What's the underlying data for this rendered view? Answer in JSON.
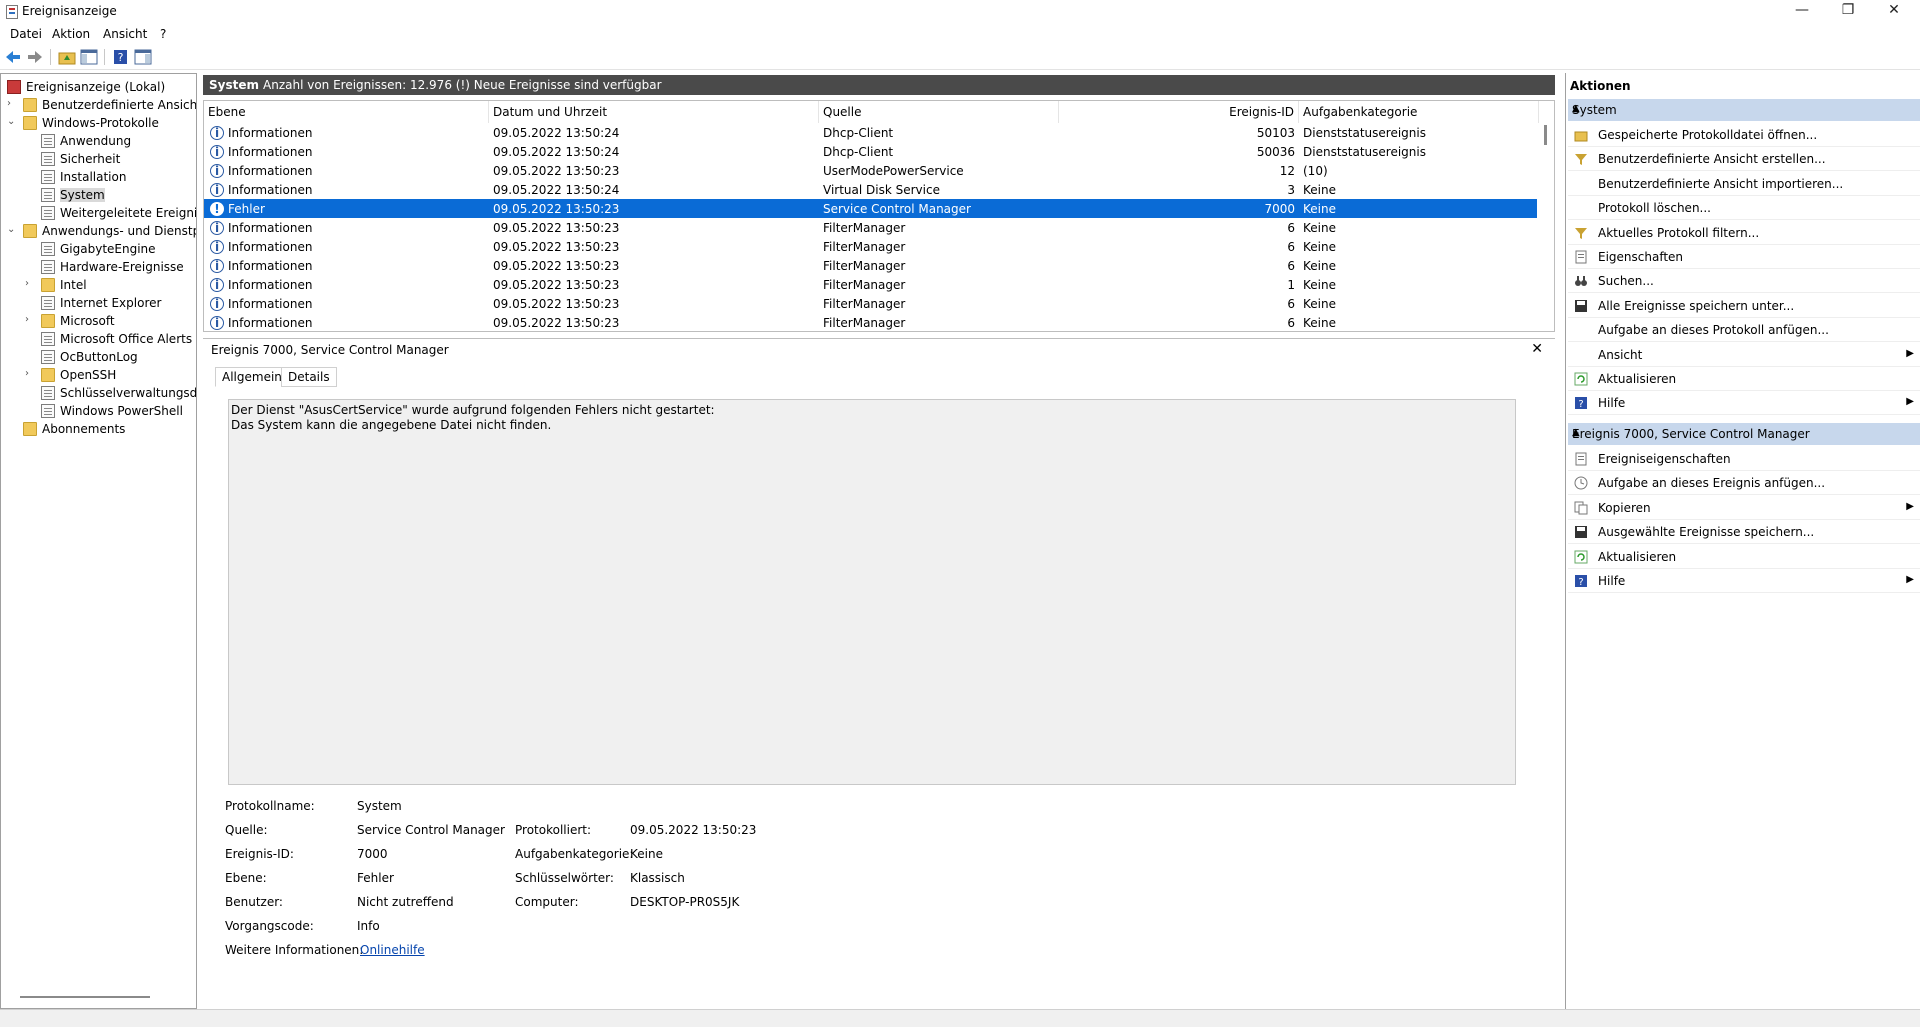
{
  "window": {
    "title": "Ereignisanzeige",
    "buttons": {
      "minimize": "—",
      "maximize": "❐",
      "close": "✕"
    }
  },
  "menu": [
    "Datei",
    "Aktion",
    "Ansicht",
    "?"
  ],
  "tree": [
    {
      "label": "Ereignisanzeige (Lokal)",
      "level": 0,
      "icon": "root"
    },
    {
      "label": "Benutzerdefinierte Ansichten",
      "level": 1,
      "icon": "folder",
      "expander": "›"
    },
    {
      "label": "Windows-Protokolle",
      "level": 1,
      "icon": "folder",
      "expander": "⌄"
    },
    {
      "label": "Anwendung",
      "level": 2,
      "icon": "log"
    },
    {
      "label": "Sicherheit",
      "level": 2,
      "icon": "log"
    },
    {
      "label": "Installation",
      "level": 2,
      "icon": "log"
    },
    {
      "label": "System",
      "level": 2,
      "icon": "log",
      "selected": true
    },
    {
      "label": "Weitergeleitete Ereignisse",
      "level": 2,
      "icon": "log"
    },
    {
      "label": "Anwendungs- und Dienstprotokolle",
      "level": 1,
      "icon": "folder",
      "expander": "⌄"
    },
    {
      "label": "GigabyteEngine",
      "level": 2,
      "icon": "log"
    },
    {
      "label": "Hardware-Ereignisse",
      "level": 2,
      "icon": "log"
    },
    {
      "label": "Intel",
      "level": 2,
      "icon": "folder",
      "expander": "›"
    },
    {
      "label": "Internet Explorer",
      "level": 2,
      "icon": "log"
    },
    {
      "label": "Microsoft",
      "level": 2,
      "icon": "folder",
      "expander": "›"
    },
    {
      "label": "Microsoft Office Alerts",
      "level": 2,
      "icon": "log"
    },
    {
      "label": "OcButtonLog",
      "level": 2,
      "icon": "log"
    },
    {
      "label": "OpenSSH",
      "level": 2,
      "icon": "folder",
      "expander": "›"
    },
    {
      "label": "Schlüsselverwaltungsdienst",
      "level": 2,
      "icon": "log"
    },
    {
      "label": "Windows PowerShell",
      "level": 2,
      "icon": "log"
    },
    {
      "label": "Abonnements",
      "level": 1,
      "icon": "folder"
    }
  ],
  "list_header": {
    "name": "System",
    "count_text": "Anzahl von Ereignissen: 12.976 (!) Neue Ereignisse sind verfügbar"
  },
  "columns": [
    "Ebene",
    "Datum und Uhrzeit",
    "Quelle",
    "Ereignis-ID",
    "Aufgabenkategorie"
  ],
  "events": [
    {
      "level": "Informationen",
      "date": "09.05.2022 13:50:24",
      "source": "Dhcp-Client",
      "id": "50103",
      "category": "Dienststatusereignis"
    },
    {
      "level": "Informationen",
      "date": "09.05.2022 13:50:24",
      "source": "Dhcp-Client",
      "id": "50036",
      "category": "Dienststatusereignis"
    },
    {
      "level": "Informationen",
      "date": "09.05.2022 13:50:23",
      "source": "UserModePowerService",
      "id": "12",
      "category": "(10)"
    },
    {
      "level": "Informationen",
      "date": "09.05.2022 13:50:24",
      "source": "Virtual Disk Service",
      "id": "3",
      "category": "Keine"
    },
    {
      "level": "Fehler",
      "date": "09.05.2022 13:50:23",
      "source": "Service Control Manager",
      "id": "7000",
      "category": "Keine",
      "selected": true
    },
    {
      "level": "Informationen",
      "date": "09.05.2022 13:50:23",
      "source": "FilterManager",
      "id": "6",
      "category": "Keine"
    },
    {
      "level": "Informationen",
      "date": "09.05.2022 13:50:23",
      "source": "FilterManager",
      "id": "6",
      "category": "Keine"
    },
    {
      "level": "Informationen",
      "date": "09.05.2022 13:50:23",
      "source": "FilterManager",
      "id": "6",
      "category": "Keine"
    },
    {
      "level": "Informationen",
      "date": "09.05.2022 13:50:23",
      "source": "FilterManager",
      "id": "1",
      "category": "Keine"
    },
    {
      "level": "Informationen",
      "date": "09.05.2022 13:50:23",
      "source": "FilterManager",
      "id": "6",
      "category": "Keine"
    },
    {
      "level": "Informationen",
      "date": "09.05.2022 13:50:23",
      "source": "FilterManager",
      "id": "6",
      "category": "Keine"
    }
  ],
  "detail": {
    "title": "Ereignis 7000, Service Control Manager",
    "close": "✕",
    "tabs": [
      "Allgemein",
      "Details"
    ],
    "message_line1": "Der Dienst \"AsusCertService\" wurde aufgrund folgenden Fehlers nicht gestartet:",
    "message_line2": "Das System kann die angegebene Datei nicht finden.",
    "props": {
      "protokollname_label": "Protokollname:",
      "protokollname": "System",
      "quelle_label": "Quelle:",
      "quelle": "Service Control Manager",
      "protokolliert_label": "Protokolliert:",
      "protokolliert": "09.05.2022 13:50:23",
      "id_label": "Ereignis-ID:",
      "id": "7000",
      "kategorie_label": "Aufgabenkategorie:",
      "kategorie": "Keine",
      "ebene_label": "Ebene:",
      "ebene": "Fehler",
      "schluessel_label": "Schlüsselwörter:",
      "schluessel": "Klassisch",
      "benutzer_label": "Benutzer:",
      "benutzer": "Nicht zutreffend",
      "computer_label": "Computer:",
      "computer": "DESKTOP-PR0S5JK",
      "vorgang_label": "Vorgangscode:",
      "vorgang": "Info",
      "weitere_label": "Weitere Informationen:",
      "weitere_link": "Onlinehilfe"
    }
  },
  "actions": {
    "heading": "Aktionen",
    "group1": "System",
    "group1_items": [
      {
        "label": "Gespeicherte Protokolldatei öffnen...",
        "icon": "open-folder-icon"
      },
      {
        "label": "Benutzerdefinierte Ansicht erstellen...",
        "icon": "filter-icon"
      },
      {
        "label": "Benutzerdefinierte Ansicht importieren...",
        "icon": ""
      },
      {
        "label": "Protokoll löschen...",
        "icon": ""
      },
      {
        "label": "Aktuelles Protokoll filtern...",
        "icon": "filter-icon"
      },
      {
        "label": "Eigenschaften",
        "icon": "properties-icon"
      },
      {
        "label": "Suchen...",
        "icon": "binoculars-icon"
      },
      {
        "label": "Alle Ereignisse speichern unter...",
        "icon": "save-icon"
      },
      {
        "label": "Aufgabe an dieses Protokoll anfügen...",
        "icon": ""
      },
      {
        "label": "Ansicht",
        "icon": "",
        "submenu": true
      },
      {
        "label": "Aktualisieren",
        "icon": "refresh-icon"
      },
      {
        "label": "Hilfe",
        "icon": "help-icon",
        "submenu": true
      }
    ],
    "group2": "Ereignis 7000, Service Control Manager",
    "group2_items": [
      {
        "label": "Ereigniseigenschaften",
        "icon": "properties-icon"
      },
      {
        "label": "Aufgabe an dieses Ereignis anfügen...",
        "icon": "task-icon"
      },
      {
        "label": "Kopieren",
        "icon": "copy-icon",
        "submenu": true
      },
      {
        "label": "Ausgewählte Ereignisse speichern...",
        "icon": "save-icon"
      },
      {
        "label": "Aktualisieren",
        "icon": "refresh-icon"
      },
      {
        "label": "Hilfe",
        "icon": "help-icon",
        "submenu": true
      }
    ]
  },
  "colors": {
    "selection": "#0a6bd6",
    "header_bar": "#4a4a4a",
    "action_group": "#c7d7ec",
    "link": "#0645ad"
  }
}
